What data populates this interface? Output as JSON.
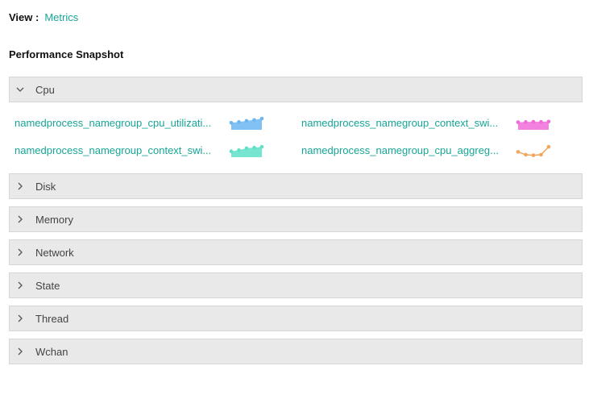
{
  "view": {
    "label": "View :",
    "value": "Metrics"
  },
  "section_title": "Performance Snapshot",
  "panels": [
    {
      "label": "Cpu",
      "expanded": true
    },
    {
      "label": "Disk",
      "expanded": false
    },
    {
      "label": "Memory",
      "expanded": false
    },
    {
      "label": "Network",
      "expanded": false
    },
    {
      "label": "State",
      "expanded": false
    },
    {
      "label": "Thread",
      "expanded": false
    },
    {
      "label": "Wchan",
      "expanded": false
    }
  ],
  "cpu_metrics": [
    {
      "name": "namedprocess_namegroup_cpu_utilizati...",
      "color": "#6cb6f2",
      "style": "area",
      "values": [
        0.55,
        0.62,
        0.72,
        0.8,
        0.92
      ]
    },
    {
      "name": "namedprocess_namegroup_context_swi...",
      "color": "#f06bd9",
      "style": "area",
      "values": [
        0.6,
        0.62,
        0.64,
        0.63,
        0.66
      ]
    },
    {
      "name": "namedprocess_namegroup_context_swi...",
      "color": "#5fe0c7",
      "style": "area",
      "values": [
        0.45,
        0.55,
        0.72,
        0.78,
        0.85
      ]
    },
    {
      "name": "namedprocess_namegroup_cpu_aggreg...",
      "color": "#f3a55a",
      "style": "line",
      "values": [
        0.4,
        0.15,
        0.1,
        0.15,
        0.85
      ]
    }
  ]
}
